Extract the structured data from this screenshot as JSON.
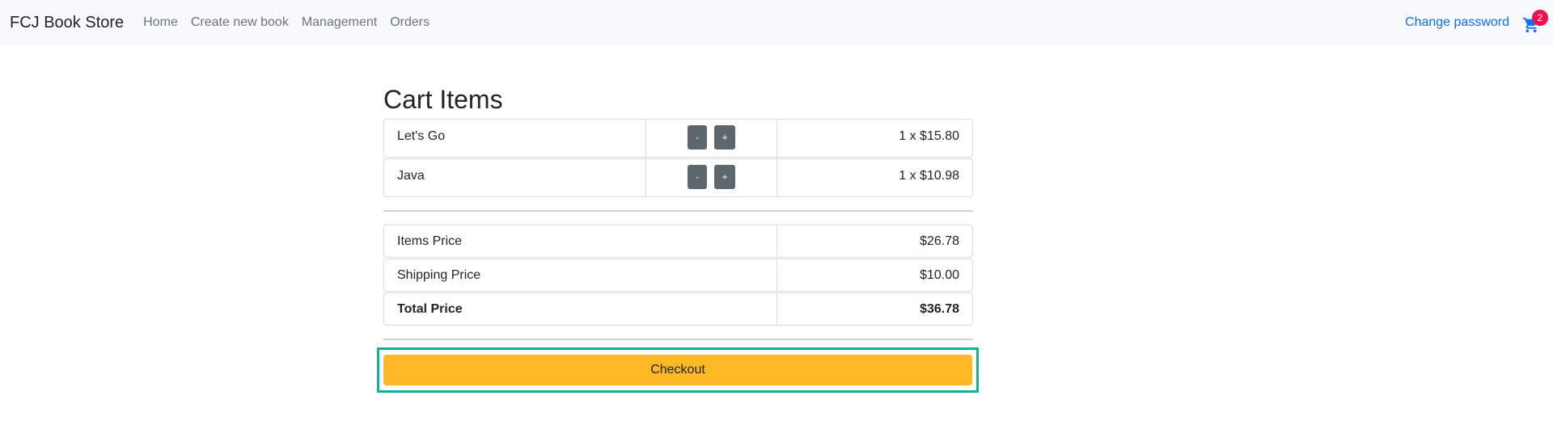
{
  "navbar": {
    "brand": "FCJ Book Store",
    "links": [
      "Home",
      "Create new book",
      "Management",
      "Orders"
    ],
    "change_password": "Change password",
    "cart_icon": "shopping-cart-icon",
    "cart_count": "2",
    "link_color": "#0d6efd",
    "badge_color": "#f50f4b"
  },
  "cart": {
    "title": "Cart Items",
    "items": [
      {
        "name": "Let's Go",
        "minus": "-",
        "plus": "+",
        "quantity_price": "1 x $15.80"
      },
      {
        "name": "Java",
        "minus": "-",
        "plus": "+",
        "quantity_price": "1 x $10.98"
      }
    ]
  },
  "summary": {
    "rows": [
      {
        "label": "Items Price",
        "value": "$26.78"
      },
      {
        "label": "Shipping Price",
        "value": "$10.00"
      },
      {
        "label": "Total Price",
        "value": "$36.78"
      }
    ]
  },
  "checkout": {
    "label": "Checkout",
    "color": "#fdb924",
    "highlight_color": "#10b39a"
  }
}
